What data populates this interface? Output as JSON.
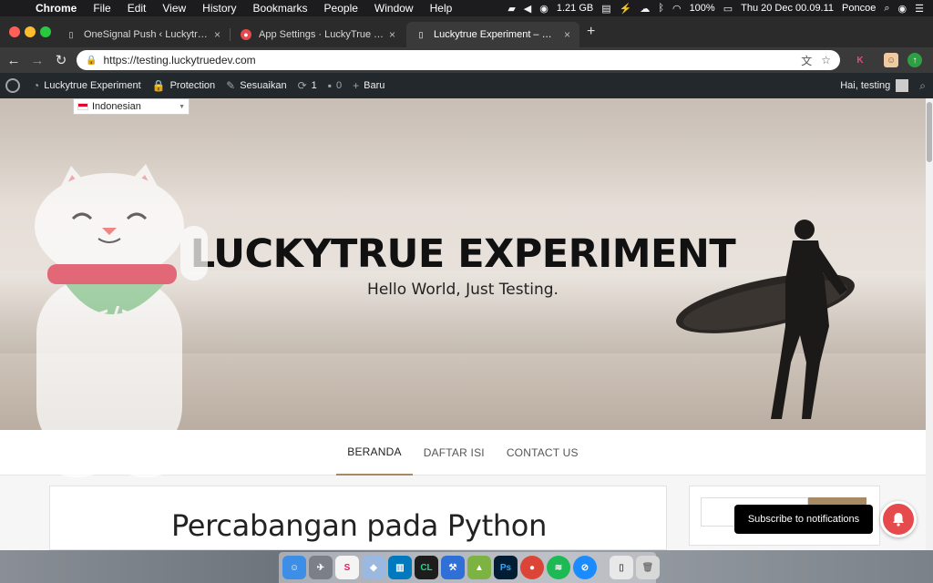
{
  "menubar": {
    "apple_icon": "apple-icon",
    "items": [
      "Chrome",
      "File",
      "Edit",
      "View",
      "History",
      "Bookmarks",
      "People",
      "Window",
      "Help"
    ],
    "memory": "1.21 GB",
    "battery": "100%",
    "clock": "Thu 20 Dec  00.09.11",
    "user": "Poncoe"
  },
  "tabs": [
    {
      "title": "OneSignal Push ‹ Luckytrue Ex",
      "favicon": "page-icon"
    },
    {
      "title": "App Settings · LuckyTrue Testi",
      "favicon": "onesignal-icon"
    },
    {
      "title": "Luckytrue Experiment – Hello W",
      "favicon": "page-icon",
      "active": true
    }
  ],
  "toolbar": {
    "url": "https://testing.luckytruedev.com"
  },
  "adminbar": {
    "site_name": "Luckytrue Experiment",
    "protection": "Protection",
    "customize": "Sesuaikan",
    "updates_count": "1",
    "comments_count": "0",
    "new_label": "Baru",
    "greeting": "Hai, testing"
  },
  "language": {
    "selected": "Indonesian"
  },
  "hero": {
    "title": "LUCKYTRUE EXPERIMENT",
    "tagline": "Hello World, Just Testing."
  },
  "nav": {
    "items": [
      "BERANDA",
      "DAFTAR ISI",
      "CONTACT US"
    ],
    "active_index": 0
  },
  "post": {
    "title": "Percabangan pada Python"
  },
  "push": {
    "tooltip": "Subscribe to notifications"
  },
  "colors": {
    "accent": "#a68a64",
    "bell": "#e54b4d",
    "adminbar": "#23282d"
  }
}
